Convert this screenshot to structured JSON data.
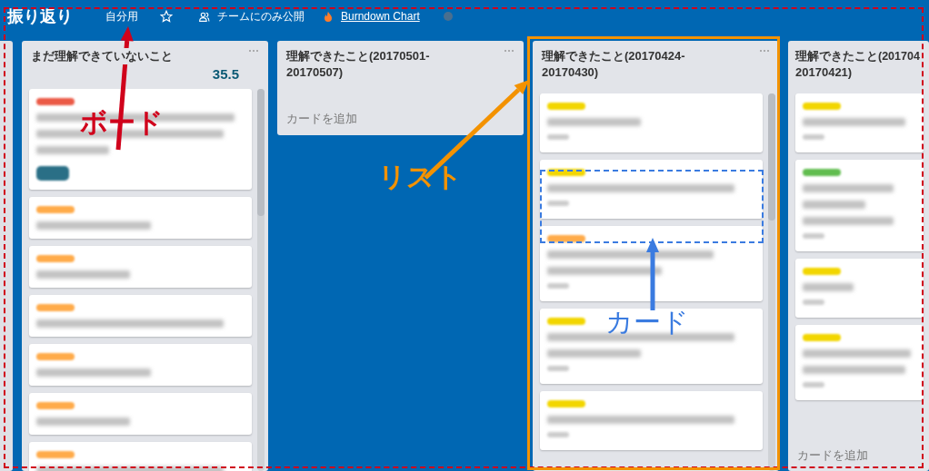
{
  "header": {
    "title": "振り返り",
    "visibility_personal": "自分用",
    "starred": false,
    "team_visibility": "チームにのみ公開",
    "power_up": "Burndown Chart"
  },
  "lists": [
    {
      "title": "まだ理解できていないこと",
      "count": "35.5",
      "scroll": true,
      "cards": [
        {
          "color": "#eb5a46",
          "kind": "three-line",
          "badge": {
            "color": "#2a6f86"
          },
          "footer": false
        },
        {
          "color": "#ffab4a",
          "kind": "one-line",
          "footer": false
        },
        {
          "color": "#ffab4a",
          "kind": "one-line",
          "footer": false
        },
        {
          "color": "#ffab4a",
          "kind": "one-line",
          "footer": false
        },
        {
          "color": "#ffab4a",
          "kind": "one-line",
          "footer": false
        },
        {
          "color": "#ffab4a",
          "kind": "one-line",
          "footer": false
        },
        {
          "color": "#ffab4a",
          "kind": "one-line",
          "footer": false
        }
      ]
    },
    {
      "title": "理解できたこと(20170501-20170507)",
      "add_card": "カードを追加"
    },
    {
      "title": "理解できたこと(20170424-20170430)",
      "scroll": true,
      "cards": [
        {
          "color": "#f2d600",
          "kind": "one-line",
          "footer": true
        },
        {
          "color": "#f2d600",
          "kind": "one-line",
          "footer": true
        },
        {
          "color": "#ffab4a",
          "kind": "two-line",
          "footer": true
        },
        {
          "color": "#f2d600",
          "kind": "two-line",
          "footer": true
        },
        {
          "color": "#f2d600",
          "kind": "one-line",
          "footer": true
        }
      ]
    },
    {
      "title": "理解できたこと(201704",
      "title_2": "20170421)",
      "add_card": "カードを追加",
      "cards": [
        {
          "color": "#f2d600",
          "kind": "one-line",
          "footer": true
        },
        {
          "color": "#61bd4f",
          "kind": "three-line",
          "footer": true
        },
        {
          "color": "#f2d600",
          "kind": "one-line",
          "footer": true
        },
        {
          "color": "#f2d600",
          "kind": "two-line",
          "footer": true
        }
      ]
    }
  ],
  "annotations": [
    {
      "kind": "board",
      "label": "ボード",
      "color": "#d0021b"
    },
    {
      "kind": "list",
      "label": "リスト",
      "color": "#f39200"
    },
    {
      "kind": "card",
      "label": "カード",
      "color": "#3a7be0"
    }
  ]
}
